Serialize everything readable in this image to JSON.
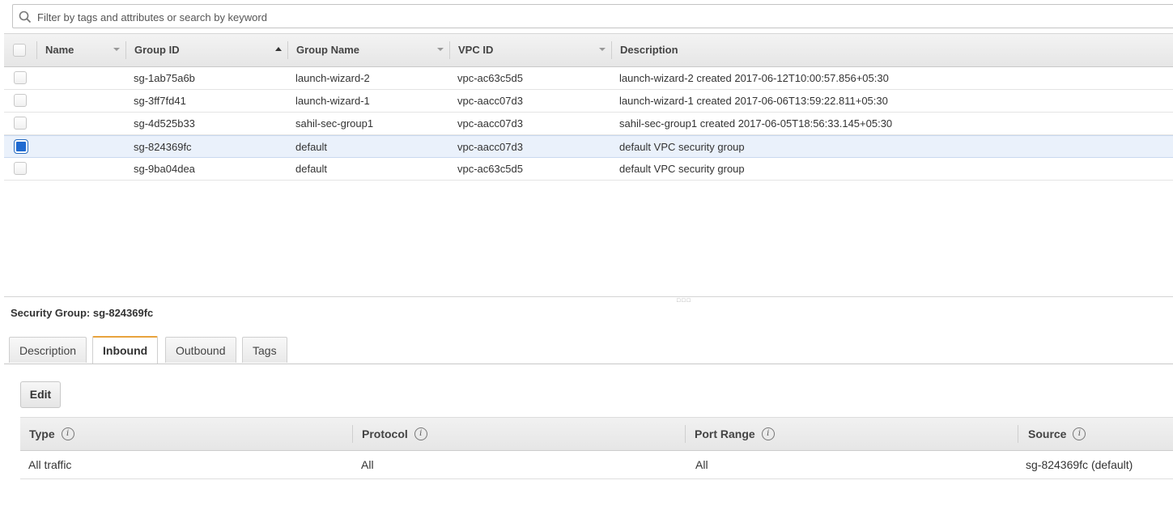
{
  "search": {
    "placeholder": "Filter by tags and attributes or search by keyword"
  },
  "grid": {
    "columns": [
      "Name",
      "Group ID",
      "Group Name",
      "VPC ID",
      "Description"
    ],
    "rows": [
      {
        "name": "",
        "group_id": "sg-1ab75a6b",
        "group_name": "launch-wizard-2",
        "vpc_id": "vpc-ac63c5d5",
        "description": "launch-wizard-2 created 2017-06-12T10:00:57.856+05:30",
        "selected": false
      },
      {
        "name": "",
        "group_id": "sg-3ff7fd41",
        "group_name": "launch-wizard-1",
        "vpc_id": "vpc-aacc07d3",
        "description": "launch-wizard-1 created 2017-06-06T13:59:22.811+05:30",
        "selected": false
      },
      {
        "name": "",
        "group_id": "sg-4d525b33",
        "group_name": "sahil-sec-group1",
        "vpc_id": "vpc-aacc07d3",
        "description": "sahil-sec-group1 created 2017-06-05T18:56:33.145+05:30",
        "selected": false
      },
      {
        "name": "",
        "group_id": "sg-824369fc",
        "group_name": "default",
        "vpc_id": "vpc-aacc07d3",
        "description": "default VPC security group",
        "selected": true
      },
      {
        "name": "",
        "group_id": "sg-9ba04dea",
        "group_name": "default",
        "vpc_id": "vpc-ac63c5d5",
        "description": "default VPC security group",
        "selected": false
      }
    ]
  },
  "detail": {
    "title": "Security Group: sg-824369fc",
    "tabs": [
      "Description",
      "Inbound",
      "Outbound",
      "Tags"
    ],
    "active_tab": "Inbound",
    "edit_label": "Edit",
    "info_glyph": "i",
    "rules": {
      "columns": [
        "Type",
        "Protocol",
        "Port Range",
        "Source"
      ],
      "rows": [
        {
          "type": "All traffic",
          "protocol": "All",
          "port_range": "All",
          "source": "sg-824369fc (default)"
        }
      ]
    }
  },
  "colors": {
    "selected_row": "#eaf1fb",
    "checkbox_checked": "#1f6ad1",
    "active_tab_accent": "#e8a33d"
  }
}
